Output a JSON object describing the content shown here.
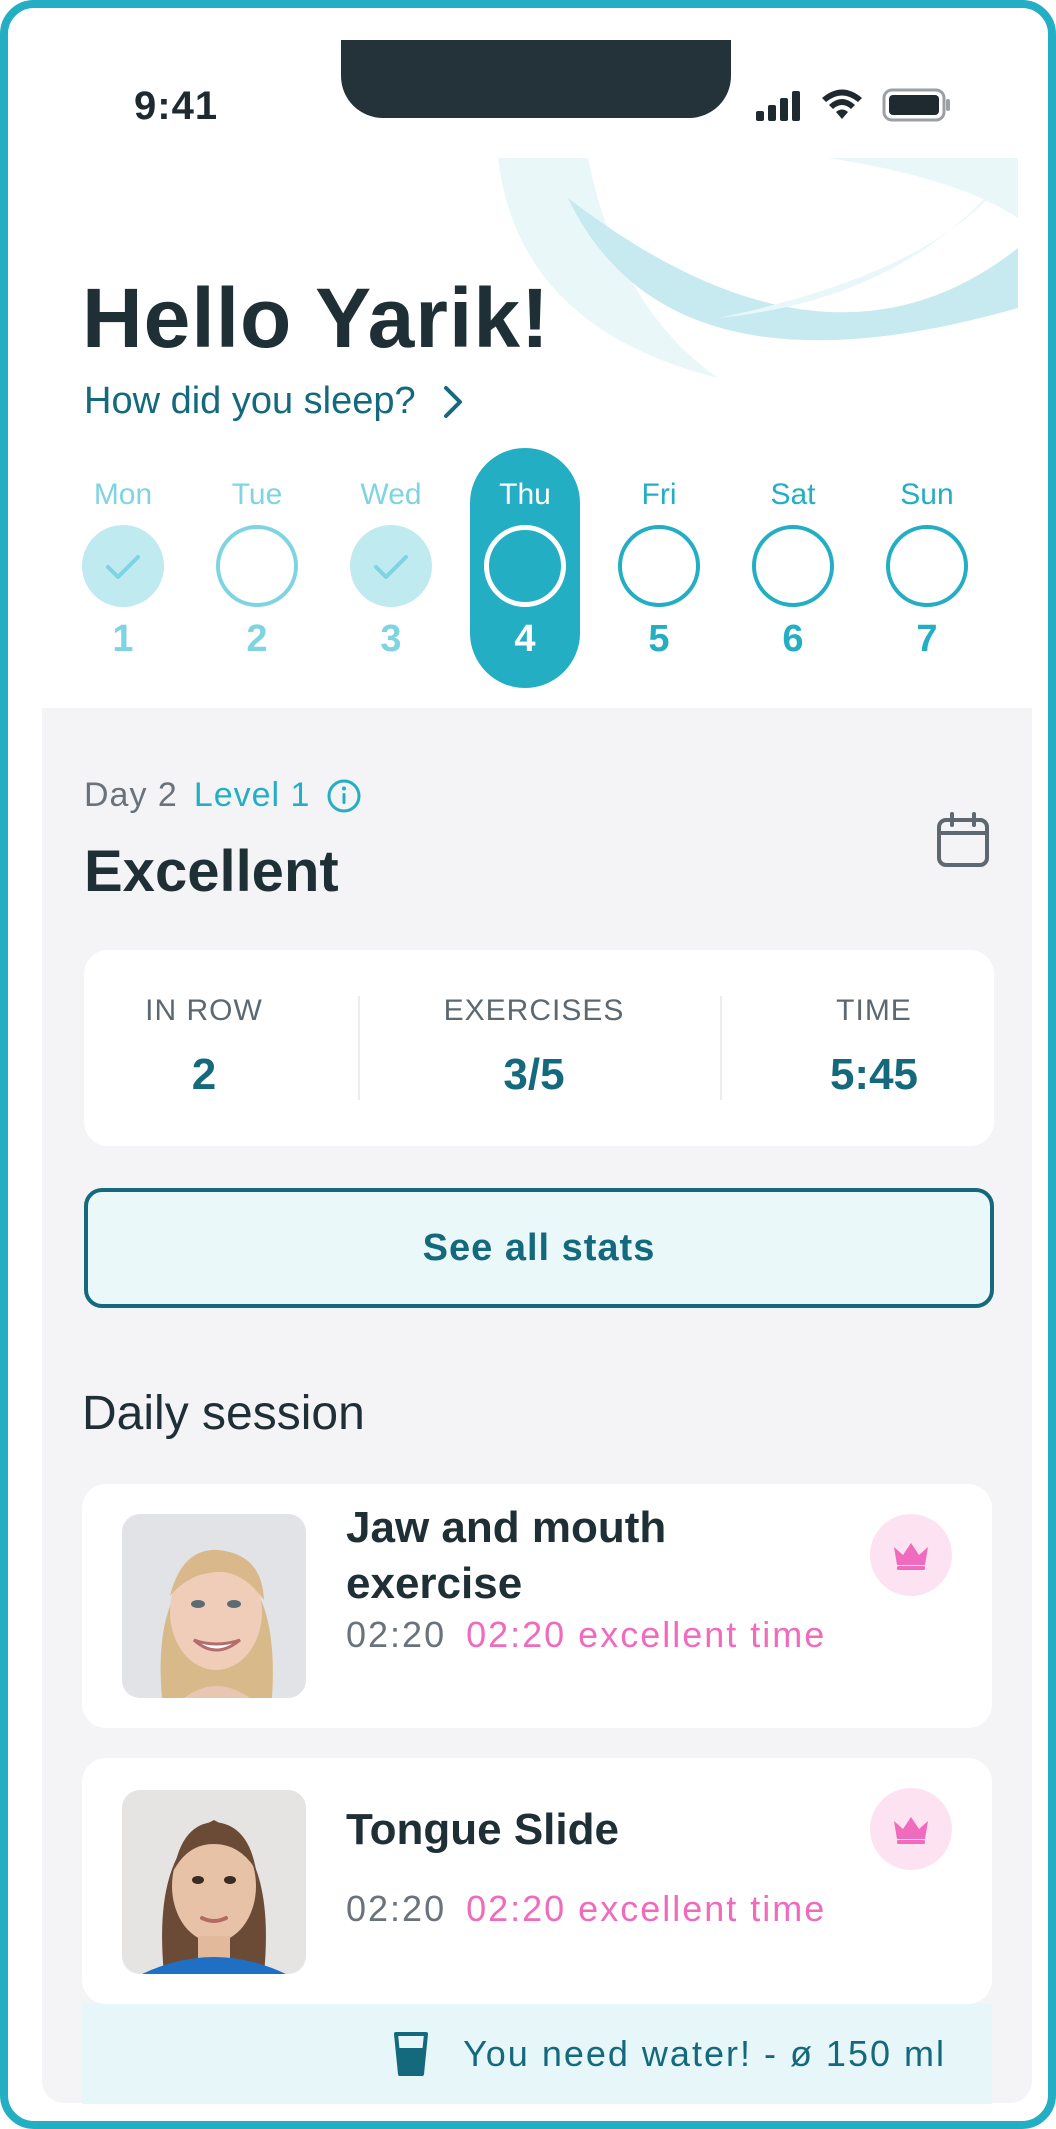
{
  "status_bar": {
    "time": "9:41"
  },
  "header": {
    "greeting": "Hello Yarik!",
    "sleep_prompt": "How did you sleep?"
  },
  "week": [
    {
      "name": "Mon",
      "num": "1",
      "state": "done"
    },
    {
      "name": "Tue",
      "num": "2",
      "state": "todo"
    },
    {
      "name": "Wed",
      "num": "3",
      "state": "done"
    },
    {
      "name": "Thu",
      "num": "4",
      "state": "active"
    },
    {
      "name": "Fri",
      "num": "5",
      "state": "future"
    },
    {
      "name": "Sat",
      "num": "6",
      "state": "future"
    },
    {
      "name": "Sun",
      "num": "7",
      "state": "future"
    }
  ],
  "progress": {
    "day_label": "Day 2",
    "level_label": "Level 1",
    "status": "Excellent"
  },
  "stats": [
    {
      "label": "IN ROW",
      "value": "2"
    },
    {
      "label": "EXERCISES",
      "value": "3/5"
    },
    {
      "label": "TIME",
      "value": "5:45"
    }
  ],
  "stats_button_label": "See all stats",
  "daily_session": {
    "title": "Daily session",
    "exercises": [
      {
        "title_line1": "Jaw and mouth",
        "title_line2": "exercise",
        "time": "02:20",
        "excellent_time": "02:20 excellent time"
      },
      {
        "title_line1": "Tongue Slide",
        "title_line2": "",
        "time": "02:20",
        "excellent_time": "02:20 excellent time"
      }
    ]
  },
  "water_notice": "You need water! - ø 150 ml",
  "colors": {
    "accent": "#23aec4",
    "dark_teal": "#146a7c",
    "pink": "#f06bbd",
    "light_accent": "#7fd4e1"
  },
  "icons": [
    "signal-icon",
    "wifi-icon",
    "battery-icon",
    "chevron-right-icon",
    "check-icon",
    "info-icon",
    "calendar-icon",
    "crown-icon",
    "water-glass-icon"
  ]
}
